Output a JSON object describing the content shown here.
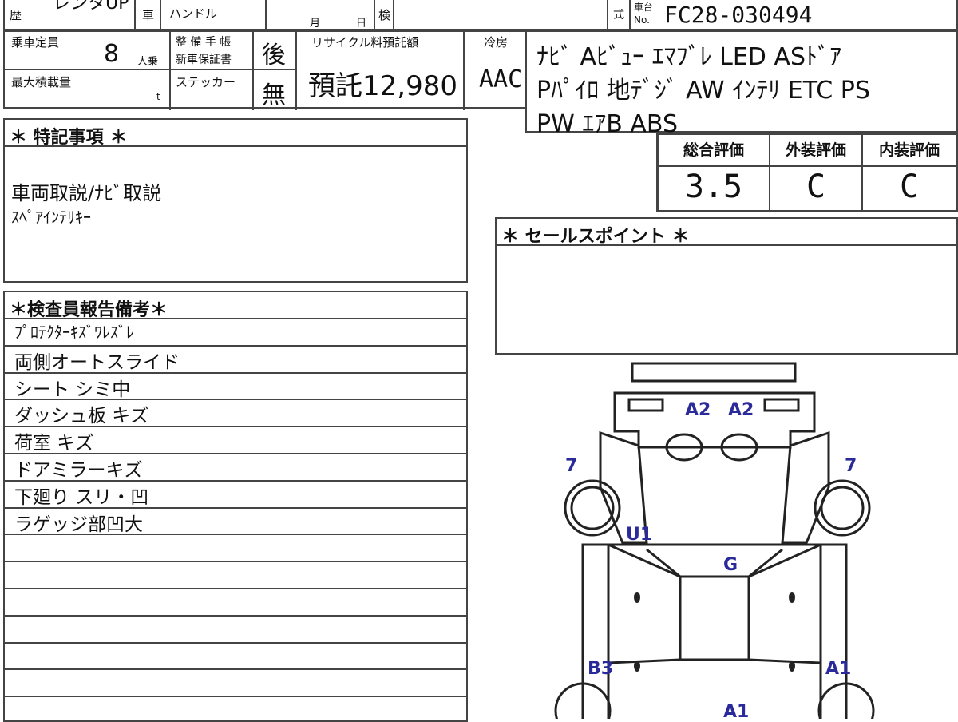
{
  "header": {
    "history_label": "歴",
    "history_value": "レンタUP",
    "car_label": "車",
    "handle_label": "ハンドル",
    "month_label": "月",
    "day_label": "日",
    "inspect_label": "検",
    "type_label": "式",
    "chassis_label_top": "車台",
    "chassis_label_bottom": "No.",
    "chassis_no": "FC28-030494"
  },
  "specs": {
    "capacity_label": "乗車定員",
    "capacity_value": "8",
    "capacity_unit": "人乗",
    "maint_label": "整 備 手 帳",
    "warranty_label": "新車保証書",
    "maint_value": "後",
    "recycle_label": "リサイクル料預託額",
    "recycle_value": "預託12,980",
    "ac_label": "冷房",
    "ac_value": "AAC",
    "max_load_label": "最大積載量",
    "max_load_unit": "t",
    "sticker_label": "ステッカー",
    "sticker_value": "無"
  },
  "equipment_lines": [
    "ﾅﾋﾞ Aﾋﾞｭｰ ｴﾏﾌﾞﾚ LED ASﾄﾞｱ",
    "Pﾊﾟｲﾛ 地ﾃﾞｼﾞ AW ｲﾝﾃﾘ ETC PS",
    "PW ｴｱB ABS"
  ],
  "grades": {
    "overall_label": "総合評価",
    "overall_value": "3.5",
    "exterior_label": "外装評価",
    "exterior_value": "C",
    "interior_label": "内装評価",
    "interior_value": "C"
  },
  "special_notes": {
    "title": "＊ 特記事項 ＊",
    "lines": [
      "車両取説/ﾅﾋﾞ取説",
      "ｽﾍﾟｱｲﾝﾃﾘｷｰ"
    ]
  },
  "sales_points": {
    "title": "＊ セールスポイント ＊"
  },
  "inspector_report": {
    "title": "＊検査員報告備考＊",
    "lines": [
      "ﾌﾟﾛﾃｸﾀｰｷｽﾞﾜﾚｽﾞﾚ",
      "両側オートスライド",
      "シート シミ中",
      "ダッシュ板 キズ",
      "荷室 キズ",
      "ドアミラーキズ",
      "下廻り スリ・凹",
      "ラゲッジ部凹大",
      "",
      "",
      "",
      "",
      "",
      "",
      ""
    ]
  },
  "diagram_marks": {
    "front_left": "A2",
    "front_right": "A2",
    "wheel_front_left": "7",
    "wheel_front_right": "7",
    "pillar_left": "U1",
    "roof": "G",
    "side_left": "B3",
    "side_right": "A1",
    "rear": "A1"
  },
  "colors": {
    "mark_color": "#2a2a9a",
    "line_color": "#444444"
  }
}
